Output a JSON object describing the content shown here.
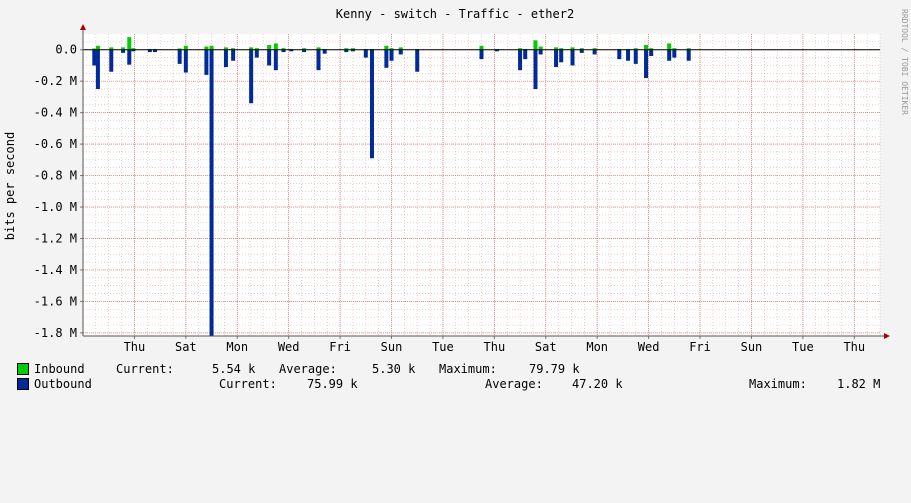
{
  "chart_data": {
    "type": "area",
    "title": "Kenny - switch - Traffic - ether2",
    "ylabel": "bits per second",
    "watermark": "RRDTOOL / TOBI OETIKER",
    "ylim": [
      -1820000,
      100000
    ],
    "y_ticks": [
      {
        "value": 0,
        "label": "0.0"
      },
      {
        "value": -200000,
        "label": "-0.2 M"
      },
      {
        "value": -400000,
        "label": "-0.4 M"
      },
      {
        "value": -600000,
        "label": "-0.6 M"
      },
      {
        "value": -800000,
        "label": "-0.8 M"
      },
      {
        "value": -1000000,
        "label": "-1.0 M"
      },
      {
        "value": -1200000,
        "label": "-1.2 M"
      },
      {
        "value": -1400000,
        "label": "-1.4 M"
      },
      {
        "value": -1600000,
        "label": "-1.6 M"
      },
      {
        "value": -1800000,
        "label": "-1.8 M"
      }
    ],
    "xlim": [
      0,
      15.5
    ],
    "x_ticks": [
      {
        "day": 1,
        "label": "Thu"
      },
      {
        "day": 2,
        "label": "Sat"
      },
      {
        "day": 3,
        "label": "Mon"
      },
      {
        "day": 4,
        "label": "Wed"
      },
      {
        "day": 5,
        "label": "Fri"
      },
      {
        "day": 6,
        "label": "Sun"
      },
      {
        "day": 7,
        "label": "Tue"
      },
      {
        "day": 8,
        "label": "Thu"
      },
      {
        "day": 9,
        "label": "Sat"
      },
      {
        "day": 10,
        "label": "Mon"
      },
      {
        "day": 11,
        "label": "Wed"
      },
      {
        "day": 12,
        "label": "Fri"
      },
      {
        "day": 13,
        "label": "Sun"
      },
      {
        "day": 14,
        "label": "Tue"
      },
      {
        "day": 15,
        "label": "Thu"
      }
    ],
    "grid": true,
    "series": [
      {
        "name": "Inbound",
        "color": "#00cc00",
        "direction": "up",
        "points": [
          [
            0.22,
            8000
          ],
          [
            0.29,
            25000
          ],
          [
            0.55,
            15000
          ],
          [
            0.78,
            15000
          ],
          [
            0.9,
            79790
          ],
          [
            0.98,
            10000
          ],
          [
            1.3,
            5000
          ],
          [
            1.4,
            5000
          ],
          [
            1.88,
            8000
          ],
          [
            2.0,
            25000
          ],
          [
            2.4,
            20000
          ],
          [
            2.5,
            25000
          ],
          [
            2.78,
            15000
          ],
          [
            2.92,
            10000
          ],
          [
            3.27,
            15000
          ],
          [
            3.38,
            10000
          ],
          [
            3.62,
            30000
          ],
          [
            3.75,
            40000
          ],
          [
            3.9,
            10000
          ],
          [
            4.05,
            5000
          ],
          [
            4.3,
            10000
          ],
          [
            4.58,
            15000
          ],
          [
            4.7,
            5000
          ],
          [
            5.12,
            10000
          ],
          [
            5.25,
            10000
          ],
          [
            5.5,
            5000
          ],
          [
            5.62,
            5000
          ],
          [
            5.9,
            25000
          ],
          [
            6.0,
            10000
          ],
          [
            6.18,
            15000
          ],
          [
            6.5,
            5000
          ],
          [
            7.75,
            25000
          ],
          [
            8.05,
            5000
          ],
          [
            8.5,
            10000
          ],
          [
            8.6,
            5000
          ],
          [
            8.8,
            60000
          ],
          [
            8.9,
            20000
          ],
          [
            9.2,
            15000
          ],
          [
            9.3,
            10000
          ],
          [
            9.52,
            15000
          ],
          [
            9.7,
            10000
          ],
          [
            9.95,
            10000
          ],
          [
            10.43,
            5000
          ],
          [
            10.6,
            5000
          ],
          [
            10.75,
            10000
          ],
          [
            10.95,
            30000
          ],
          [
            11.05,
            10000
          ],
          [
            11.4,
            40000
          ],
          [
            11.5,
            10000
          ],
          [
            11.78,
            10000
          ]
        ]
      },
      {
        "name": "Outbound",
        "color": "#002a97",
        "direction": "down",
        "points": [
          [
            0.22,
            100000
          ],
          [
            0.29,
            250000
          ],
          [
            0.55,
            140000
          ],
          [
            0.78,
            20000
          ],
          [
            0.9,
            95000
          ],
          [
            0.98,
            10000
          ],
          [
            1.3,
            15000
          ],
          [
            1.4,
            15000
          ],
          [
            1.88,
            90000
          ],
          [
            2.0,
            145000
          ],
          [
            2.4,
            160000
          ],
          [
            2.5,
            1820000
          ],
          [
            2.78,
            110000
          ],
          [
            2.92,
            70000
          ],
          [
            3.27,
            340000
          ],
          [
            3.38,
            50000
          ],
          [
            3.62,
            100000
          ],
          [
            3.75,
            130000
          ],
          [
            3.9,
            15000
          ],
          [
            4.05,
            10000
          ],
          [
            4.3,
            15000
          ],
          [
            4.58,
            130000
          ],
          [
            4.7,
            25000
          ],
          [
            5.12,
            15000
          ],
          [
            5.25,
            10000
          ],
          [
            5.5,
            50000
          ],
          [
            5.62,
            690000
          ],
          [
            5.9,
            115000
          ],
          [
            6.0,
            70000
          ],
          [
            6.18,
            30000
          ],
          [
            6.5,
            140000
          ],
          [
            7.75,
            60000
          ],
          [
            8.05,
            10000
          ],
          [
            8.5,
            130000
          ],
          [
            8.6,
            60000
          ],
          [
            8.8,
            250000
          ],
          [
            8.9,
            30000
          ],
          [
            9.2,
            110000
          ],
          [
            9.3,
            80000
          ],
          [
            9.52,
            100000
          ],
          [
            9.7,
            20000
          ],
          [
            9.95,
            30000
          ],
          [
            10.43,
            60000
          ],
          [
            10.6,
            70000
          ],
          [
            10.75,
            90000
          ],
          [
            10.95,
            180000
          ],
          [
            11.05,
            40000
          ],
          [
            11.4,
            70000
          ],
          [
            11.5,
            50000
          ],
          [
            11.78,
            70000
          ]
        ]
      }
    ]
  },
  "legend": [
    {
      "name": "Inbound",
      "current_label": "Current:",
      "current_value": "5.54 k",
      "average_label": "Average:",
      "average_value": "5.30 k",
      "maximum_label": "Maximum:",
      "maximum_value": "79.79 k"
    },
    {
      "name": "Outbound",
      "current_label": "Current:",
      "current_value": "75.99 k",
      "average_label": "Average:",
      "average_value": "47.20 k",
      "maximum_label": "Maximum:",
      "maximum_value": "1.82 M"
    }
  ]
}
